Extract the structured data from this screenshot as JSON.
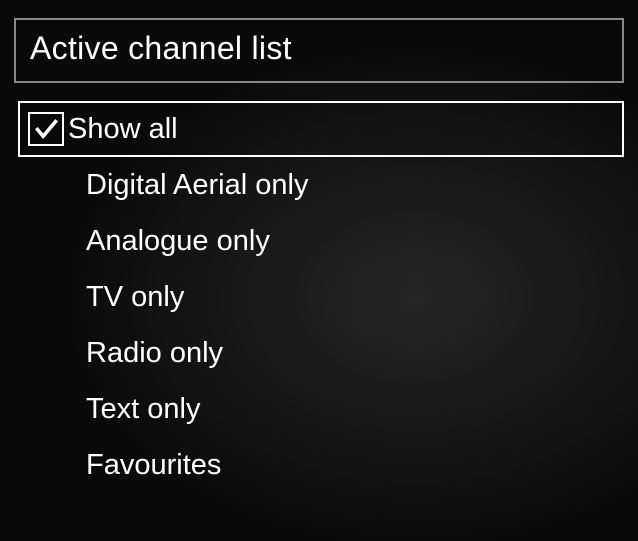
{
  "title": "Active channel list",
  "items": [
    {
      "label": "Show all",
      "checked": true,
      "selected": true
    },
    {
      "label": "Digital Aerial only",
      "checked": false,
      "selected": false
    },
    {
      "label": "Analogue only",
      "checked": false,
      "selected": false
    },
    {
      "label": "TV only",
      "checked": false,
      "selected": false
    },
    {
      "label": "Radio only",
      "checked": false,
      "selected": false
    },
    {
      "label": "Text only",
      "checked": false,
      "selected": false
    },
    {
      "label": "Favourites",
      "checked": false,
      "selected": false
    }
  ]
}
